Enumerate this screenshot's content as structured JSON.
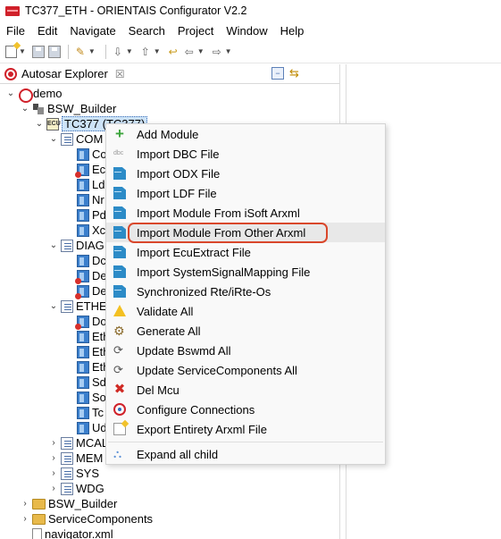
{
  "window": {
    "title": "TC377_ETH - ORIENTAIS Configurator V2.2"
  },
  "menubar": {
    "items": [
      "File",
      "Edit",
      "Navigate",
      "Search",
      "Project",
      "Window",
      "Help"
    ]
  },
  "explorer": {
    "tab_title": "Autosar Explorer",
    "close_glyph": "☒"
  },
  "tree": {
    "demo": "demo",
    "bsw_builder": "BSW_Builder",
    "tc377": "TC377 (TC377)",
    "ecu_icon_text": "ECU",
    "com": {
      "label": "COM",
      "children": [
        "Co",
        "Ecu",
        "Ld",
        "Nr",
        "Pd",
        "Xc"
      ]
    },
    "diag": {
      "label": "DIAG",
      "children": [
        "Dc",
        "De",
        "De"
      ]
    },
    "ethe": {
      "label": "ETHE",
      "children": [
        "Do",
        "Eth",
        "Eth",
        "Eth",
        "Sd",
        "So",
        "Tc",
        "Ud"
      ]
    },
    "mcal": "MCAL",
    "mem": "MEM",
    "sys": "SYS",
    "wdg": "WDG",
    "bsw_builder_2": "BSW_Builder",
    "service_components": "ServiceComponents",
    "navigator": "navigator.xml"
  },
  "context_menu": {
    "items": [
      {
        "label": "Add Module",
        "icon": "add-icon"
      },
      {
        "label": "Import DBC File",
        "icon": "dbc-icon"
      },
      {
        "label": "Import ODX File",
        "icon": "document-icon"
      },
      {
        "label": "Import LDF File",
        "icon": "document-icon"
      },
      {
        "label": "Import Module From iSoft Arxml",
        "icon": "document-icon"
      },
      {
        "label": "Import Module From Other Arxml",
        "icon": "document-icon",
        "highlighted": true
      },
      {
        "label": "Import EcuExtract File",
        "icon": "document-icon"
      },
      {
        "label": "Import SystemSignalMapping File",
        "icon": "document-icon"
      },
      {
        "label": "Synchronized Rte/iRte-Os",
        "icon": "document-icon"
      },
      {
        "label": "Validate All",
        "icon": "warning-icon"
      },
      {
        "label": "Generate All",
        "icon": "gear-icon"
      },
      {
        "label": "Update Bswmd All",
        "icon": "update-icon"
      },
      {
        "label": "Update ServiceComponents All",
        "icon": "update-icon"
      },
      {
        "label": "Del Mcu",
        "icon": "delete-icon"
      },
      {
        "label": "Configure Connections",
        "icon": "connection-icon"
      },
      {
        "label": "Export Entirety Arxml File",
        "icon": "export-icon"
      },
      {
        "label": "Expand all child",
        "icon": "expand-icon"
      }
    ]
  },
  "colors": {
    "highlight_box": "#d9472b",
    "selection": "#cde3f7",
    "brand_red": "#d0212a"
  }
}
